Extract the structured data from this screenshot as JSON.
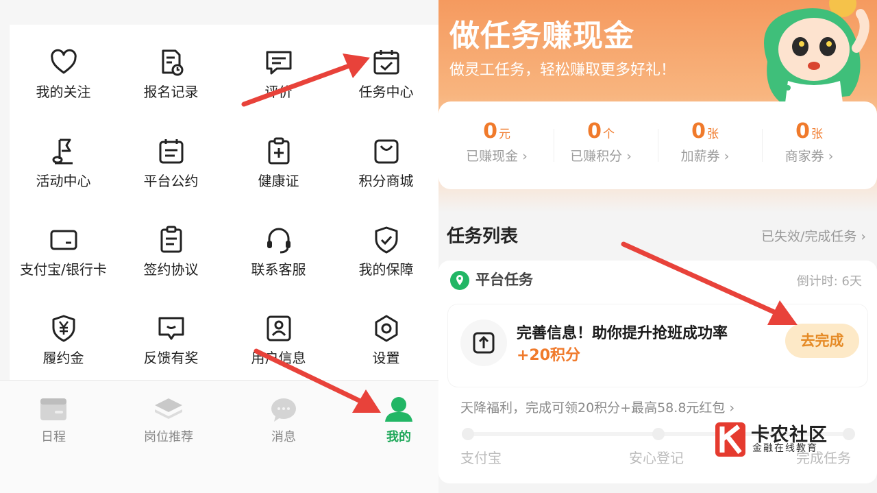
{
  "left": {
    "grid": [
      {
        "label": "我的关注",
        "icon": "heart-icon"
      },
      {
        "label": "报名记录",
        "icon": "document-clock-icon"
      },
      {
        "label": "评价",
        "icon": "chat-bubble-icon"
      },
      {
        "label": "任务中心",
        "icon": "calendar-check-icon"
      },
      {
        "label": "活动中心",
        "icon": "flag-icon"
      },
      {
        "label": "平台公约",
        "icon": "calendar-doc-icon"
      },
      {
        "label": "健康证",
        "icon": "medical-clipboard-icon"
      },
      {
        "label": "积分商城",
        "icon": "shopping-bag-icon"
      },
      {
        "label": "支付宝/银行卡",
        "icon": "card-icon"
      },
      {
        "label": "签约协议",
        "icon": "clipboard-icon"
      },
      {
        "label": "联系客服",
        "icon": "headset-icon"
      },
      {
        "label": "我的保障",
        "icon": "shield-check-icon"
      },
      {
        "label": "履约金",
        "icon": "yen-shield-icon"
      },
      {
        "label": "反馈有奖",
        "icon": "feedback-icon"
      },
      {
        "label": "用户信息",
        "icon": "user-card-icon"
      },
      {
        "label": "设置",
        "icon": "gear-icon"
      }
    ],
    "tabs": [
      {
        "label": "日程",
        "icon": "schedule-icon",
        "active": false
      },
      {
        "label": "岗位推荐",
        "icon": "layers-icon",
        "active": false
      },
      {
        "label": "消息",
        "icon": "message-icon",
        "active": false
      },
      {
        "label": "我的",
        "icon": "person-icon",
        "active": true
      }
    ]
  },
  "right": {
    "banner": {
      "title": "做任务赚现金",
      "subtitle": "做灵工任务，轻松赚取更多好礼！"
    },
    "stats": [
      {
        "value": "0",
        "unit": "元",
        "label": "已赚现金"
      },
      {
        "value": "0",
        "unit": "个",
        "label": "已赚积分"
      },
      {
        "value": "0",
        "unit": "张",
        "label": "加薪券"
      },
      {
        "value": "0",
        "unit": "张",
        "label": "商家券"
      }
    ],
    "list": {
      "title": "任务列表",
      "link": "已失效/完成任务"
    },
    "task": {
      "category": "平台任务",
      "countdown": "倒计时: 6天",
      "title": "完善信息！助你提升抢班成功率",
      "points": "+20积分",
      "button": "去完成",
      "bonus": "天降福利，完成可领20积分+最高58.8元红包",
      "steps": [
        "支付宝",
        "安心登记",
        "完成任务"
      ]
    },
    "watermark": {
      "title": "卡农社区",
      "subtitle": "金融在线教育"
    }
  },
  "colors": {
    "accent_orange": "#f07a2b",
    "active_green": "#1fa85a",
    "arrow_red": "#e8423a",
    "banner_orange": "#f59a5f"
  }
}
